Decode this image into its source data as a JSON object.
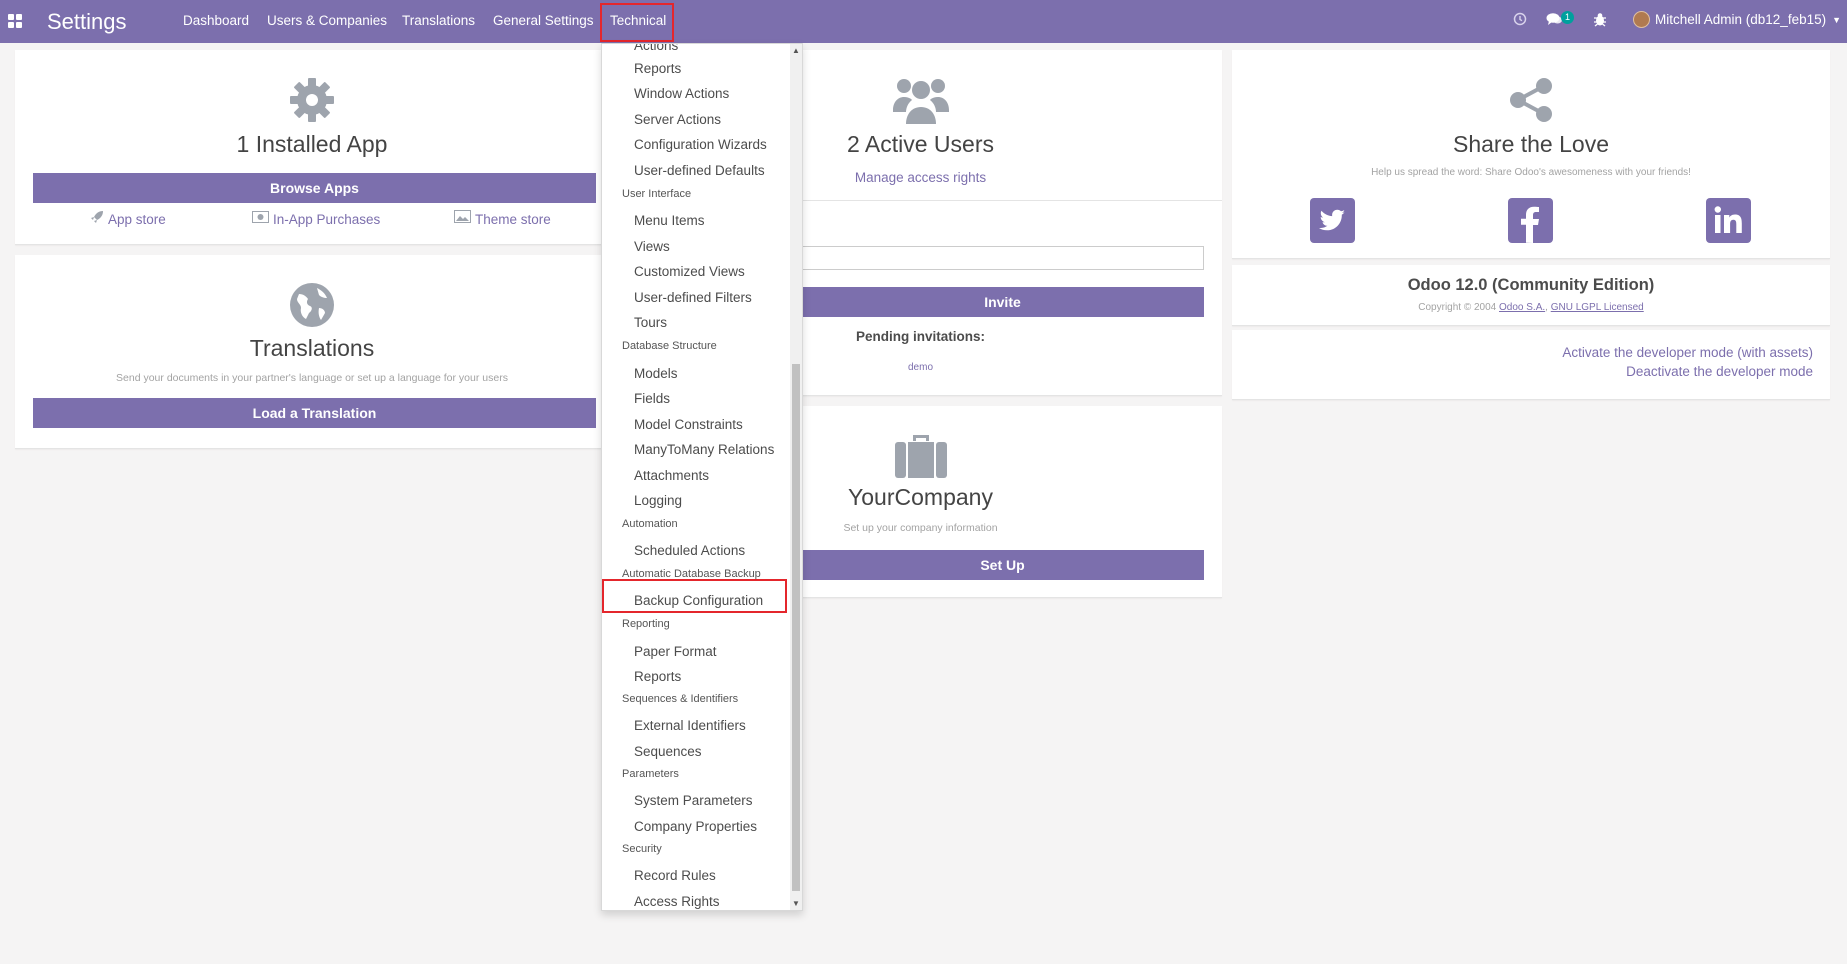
{
  "navbar": {
    "brand": "Settings",
    "menu": [
      "Dashboard",
      "Users & Companies",
      "Translations",
      "General Settings",
      "Technical"
    ],
    "messages_badge": "1",
    "user": "Mitchell Admin (db12_feb15)"
  },
  "apps_card": {
    "title": "1 Installed App",
    "button": "Browse Apps",
    "links": [
      "App store",
      "In-App Purchases",
      "Theme store"
    ]
  },
  "translations_card": {
    "title": "Translations",
    "subtitle": "Send your documents in your partner's language or set up a language for your users",
    "button": "Load a Translation"
  },
  "users_card": {
    "title": "2 Active Users",
    "link": "Manage access rights",
    "invite_button": "Invite",
    "pending_label": "Pending invitations:",
    "pending_user": "demo"
  },
  "company_card": {
    "title": "YourCompany",
    "subtitle": "Set up your company information",
    "button": "Set Up"
  },
  "share_card": {
    "title": "Share the Love",
    "subtitle": "Help us spread the word: Share Odoo's awesomeness with your friends!"
  },
  "version_card": {
    "title": "Odoo 12.0 (Community Edition)",
    "copyright_prefix": "Copyright © 2004",
    "company_link": "Odoo S.A.",
    "license_link": "GNU LGPL Licensed"
  },
  "developer_card": {
    "activate_link": "Activate the developer mode (with assets)",
    "deactivate_link": "Deactivate the developer mode"
  },
  "technical_dropdown": {
    "partial_top": "Actions",
    "items": [
      {
        "type": "item",
        "label": "Reports"
      },
      {
        "type": "item",
        "label": "Window Actions"
      },
      {
        "type": "item",
        "label": "Server Actions"
      },
      {
        "type": "item",
        "label": "Configuration Wizards"
      },
      {
        "type": "item",
        "label": "User-defined Defaults"
      },
      {
        "type": "header",
        "label": "User Interface"
      },
      {
        "type": "item",
        "label": "Menu Items"
      },
      {
        "type": "item",
        "label": "Views"
      },
      {
        "type": "item",
        "label": "Customized Views"
      },
      {
        "type": "item",
        "label": "User-defined Filters"
      },
      {
        "type": "item",
        "label": "Tours"
      },
      {
        "type": "header",
        "label": "Database Structure"
      },
      {
        "type": "item",
        "label": "Models"
      },
      {
        "type": "item",
        "label": "Fields"
      },
      {
        "type": "item",
        "label": "Model Constraints"
      },
      {
        "type": "item",
        "label": "ManyToMany Relations"
      },
      {
        "type": "item",
        "label": "Attachments"
      },
      {
        "type": "item",
        "label": "Logging"
      },
      {
        "type": "header",
        "label": "Automation"
      },
      {
        "type": "item",
        "label": "Scheduled Actions"
      },
      {
        "type": "header",
        "label": "Automatic Database Backup"
      },
      {
        "type": "item",
        "label": "Backup Configuration"
      },
      {
        "type": "header",
        "label": "Reporting"
      },
      {
        "type": "item",
        "label": "Paper Format"
      },
      {
        "type": "item",
        "label": "Reports"
      },
      {
        "type": "header",
        "label": "Sequences & Identifiers"
      },
      {
        "type": "item",
        "label": "External Identifiers"
      },
      {
        "type": "item",
        "label": "Sequences"
      },
      {
        "type": "header",
        "label": "Parameters"
      },
      {
        "type": "item",
        "label": "System Parameters"
      },
      {
        "type": "item",
        "label": "Company Properties"
      },
      {
        "type": "header",
        "label": "Security"
      },
      {
        "type": "item",
        "label": "Record Rules"
      },
      {
        "type": "item",
        "label": "Access Rights"
      }
    ]
  }
}
